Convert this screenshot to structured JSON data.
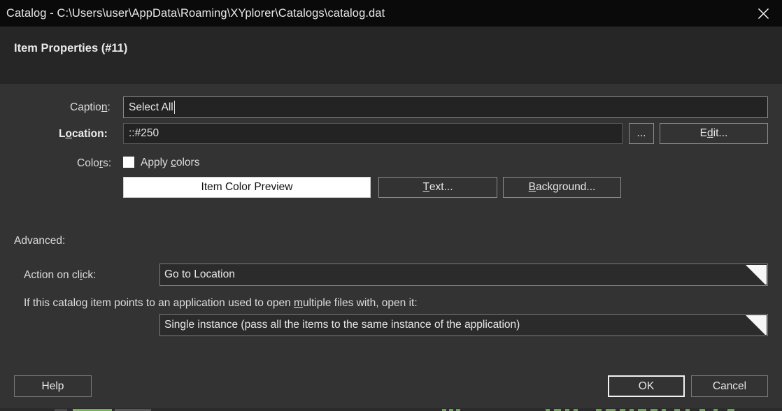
{
  "window": {
    "title": "Catalog - C:\\Users\\user\\AppData\\Roaming\\XYplorer\\Catalogs\\catalog.dat",
    "close_icon": "close-icon"
  },
  "header": {
    "title": "Item Properties (#11)"
  },
  "form": {
    "caption": {
      "label_pre": "Captio",
      "label_accel": "n",
      "label_post": ":",
      "value": "Select All",
      "placeholder": ""
    },
    "location": {
      "label_pre": "L",
      "label_accel": "o",
      "label_post": "cation:",
      "value": "::#250",
      "placeholder": "",
      "browse_label": "...",
      "edit_pre": "E",
      "edit_accel": "d",
      "edit_post": "it..."
    },
    "colors": {
      "label_pre": "Colo",
      "label_accel": "r",
      "label_post": "s:",
      "apply_pre": "Apply ",
      "apply_accel": "c",
      "apply_post": "olors",
      "apply_checked": false,
      "preview_label": "Item Color Preview",
      "text_pre": "",
      "text_accel": "T",
      "text_post": "ext...",
      "background_pre": "",
      "background_accel": "B",
      "background_post": "ackground..."
    }
  },
  "advanced": {
    "section_label": "Advanced:",
    "action_on_click": {
      "label_pre": "Action on cl",
      "label_accel": "i",
      "label_post": "ck:",
      "value": "Go to Location"
    },
    "multi_open": {
      "label_pre": "If this catalog item points to an application used to open ",
      "label_accel": "m",
      "label_post": "ultiple files with, open it:",
      "value": "Single instance (pass all the items to the same instance of the application)"
    }
  },
  "footer": {
    "help_label": "Help",
    "ok_label": "OK",
    "cancel_label": "Cancel"
  },
  "colors": {
    "titlebar_bg": "#0a0a0a",
    "header_bg": "#262626",
    "dialog_bg": "#333333",
    "field_bg": "#232323",
    "combo_bg": "#2b2b2b",
    "text": "#e6e6e6",
    "border": "#8c8c8c",
    "accent_white": "#ffffff"
  }
}
